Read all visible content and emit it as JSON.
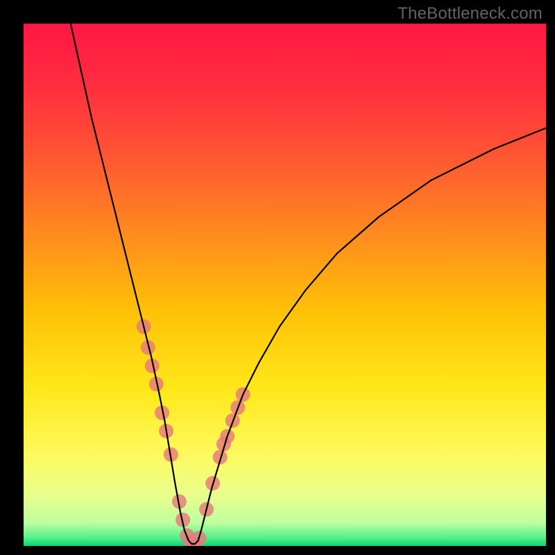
{
  "watermark": "TheBottleneck.com",
  "chart_data": {
    "type": "line",
    "title": "",
    "xlabel": "",
    "ylabel": "",
    "xlim": [
      0,
      100
    ],
    "ylim": [
      0,
      100
    ],
    "curve": {
      "x": [
        9.0,
        11.0,
        13.0,
        15.0,
        17.0,
        18.5,
        20.0,
        21.5,
        23.0,
        24.5,
        26.0,
        27.0,
        28.0,
        29.0,
        30.0,
        30.8,
        31.6,
        32.2,
        32.8,
        33.4,
        34.0,
        36.0,
        39.0,
        42.0,
        45.0,
        49.0,
        54.0,
        60.0,
        68.0,
        78.0,
        90.0,
        100.0
      ],
      "y": [
        100.0,
        91.0,
        82.0,
        74.0,
        66.0,
        60.0,
        54.0,
        48.0,
        42.0,
        36.0,
        29.0,
        24.0,
        18.0,
        12.0,
        6.5,
        3.0,
        1.0,
        0.4,
        0.4,
        1.0,
        3.0,
        11.0,
        21.0,
        29.0,
        35.0,
        42.0,
        49.0,
        56.0,
        63.0,
        70.0,
        76.0,
        80.0
      ]
    },
    "markers": {
      "x": [
        23.0,
        23.8,
        24.6,
        25.4,
        26.5,
        27.3,
        28.2,
        29.8,
        30.5,
        31.3,
        32.0,
        32.8,
        33.6,
        35.0,
        36.2,
        37.6,
        38.3,
        39.0,
        40.0,
        41.0,
        42.0
      ],
      "y": [
        42.0,
        38.0,
        34.5,
        31.0,
        25.5,
        22.0,
        17.5,
        8.5,
        5.0,
        2.0,
        0.7,
        0.4,
        1.5,
        7.0,
        12.0,
        17.0,
        19.5,
        21.0,
        24.0,
        26.5,
        29.0
      ]
    },
    "gradient_stops": [
      {
        "offset": 0.0,
        "color": "#ff1744"
      },
      {
        "offset": 0.12,
        "color": "#ff2e3f"
      },
      {
        "offset": 0.25,
        "color": "#ff5533"
      },
      {
        "offset": 0.4,
        "color": "#ff8a1f"
      },
      {
        "offset": 0.55,
        "color": "#ffc107"
      },
      {
        "offset": 0.7,
        "color": "#ffe81a"
      },
      {
        "offset": 0.82,
        "color": "#fff95b"
      },
      {
        "offset": 0.9,
        "color": "#eaff8a"
      },
      {
        "offset": 0.955,
        "color": "#bfffa0"
      },
      {
        "offset": 0.985,
        "color": "#55ee88"
      },
      {
        "offset": 1.0,
        "color": "#00d877"
      }
    ],
    "marker_style": {
      "fill": "#e77a7a",
      "opacity": 0.82,
      "r": 10.5
    },
    "line_style": {
      "stroke": "#000000",
      "width": 2.2
    }
  }
}
